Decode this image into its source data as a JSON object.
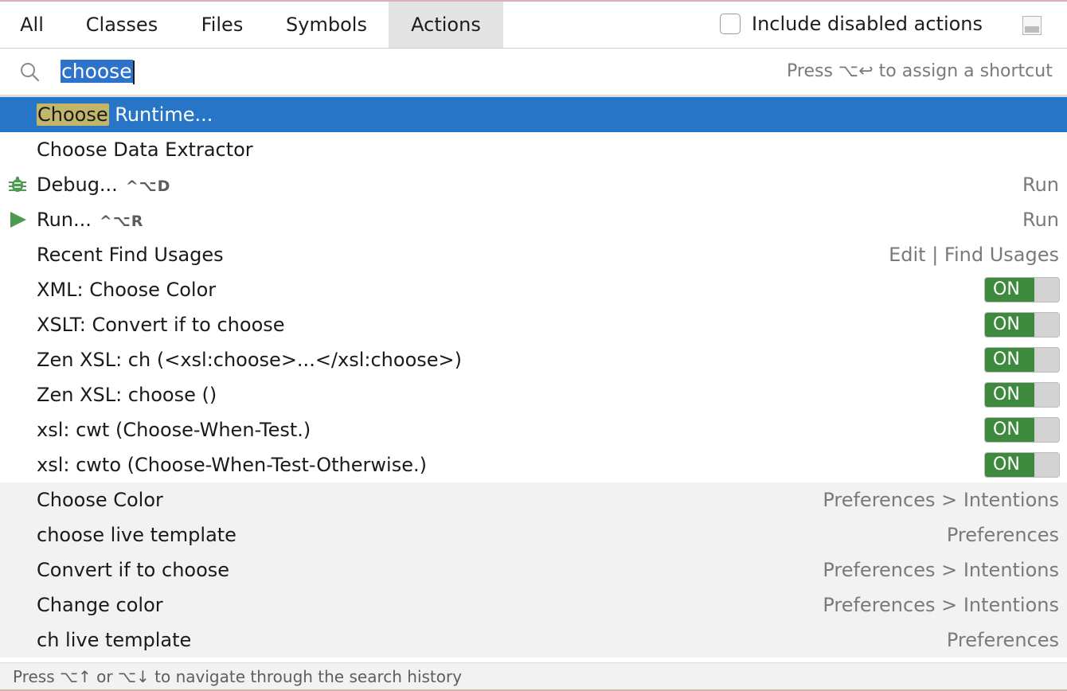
{
  "tabs": [
    {
      "label": "All"
    },
    {
      "label": "Classes"
    },
    {
      "label": "Files"
    },
    {
      "label": "Symbols"
    },
    {
      "label": "Actions",
      "active": true
    }
  ],
  "include_disabled": {
    "label": "Include disabled actions",
    "checked": false
  },
  "search": {
    "value": "choose",
    "hint": "Press ⌥↩ to assign a shortcut"
  },
  "results": [
    {
      "highlight": "Choose",
      "label": " Runtime...",
      "selected": true
    },
    {
      "label": "Choose Data Extractor"
    },
    {
      "label": "Debug...",
      "shortcut": "^⌥D",
      "right": "Run",
      "icon": "debug-bug-icon"
    },
    {
      "label": "Run...",
      "shortcut": "^⌥R",
      "right": "Run",
      "icon": "run-play-icon"
    },
    {
      "label": "Recent Find Usages",
      "right": "Edit | Find Usages"
    },
    {
      "label": "XML: Choose Color",
      "toggle": "ON"
    },
    {
      "label": "XSLT: Convert if to choose",
      "toggle": "ON"
    },
    {
      "label": "Zen XSL: ch (<xsl:choose>...</xsl:choose>)",
      "toggle": "ON"
    },
    {
      "label": "Zen XSL: choose ()",
      "toggle": "ON"
    },
    {
      "label": "xsl: cwt (Choose-When-Test.)",
      "toggle": "ON"
    },
    {
      "label": "xsl: cwto (Choose-When-Test-Otherwise.)",
      "toggle": "ON"
    },
    {
      "label": "Choose Color",
      "right": "Preferences > Intentions",
      "gray": true
    },
    {
      "label": "choose live template",
      "right": "Preferences",
      "gray": true
    },
    {
      "label": "Convert if to choose",
      "right": "Preferences > Intentions",
      "gray": true
    },
    {
      "label": "Change color",
      "right": "Preferences > Intentions",
      "gray": true
    },
    {
      "label": "ch live template",
      "right": "Preferences",
      "gray": true
    }
  ],
  "footer": {
    "text": "Press ⌥↑ or ⌥↓ to navigate through the search history"
  },
  "colors": {
    "selection": "#2675c6",
    "toggle_on": "#3d8a3e",
    "highlight": "#c2b66a"
  }
}
